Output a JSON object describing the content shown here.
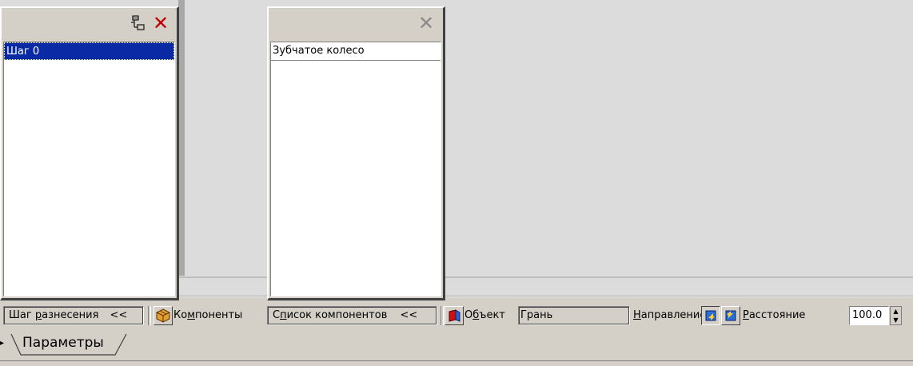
{
  "steps_panel": {
    "items": [
      "Шаг 0"
    ],
    "icons": [
      "tree-structure-icon",
      "delete-red-x-icon"
    ]
  },
  "components_panel": {
    "items": [
      "Зубчатое колесо"
    ],
    "icons": [
      "close-gray-x-icon"
    ]
  },
  "toolbar": {
    "step_field": {
      "text_underlined_prefix": "Шаг ",
      "text_underlined": "р",
      "text_rest": "азнесения",
      "suffix": "<<"
    },
    "components_label": {
      "pre": "Ко",
      "underlined": "м",
      "post": "поненты"
    },
    "components_list_field": {
      "pre": "С",
      "underlined": "п",
      "post": "исок компонентов",
      "suffix": "<<"
    },
    "object_label": {
      "pre": "О",
      "underlined": "б",
      "post": "ъект"
    },
    "object_value": "Грань",
    "direction_label": {
      "underlined": "Н",
      "post": "аправление"
    },
    "distance_label": {
      "underlined": "Р",
      "post": "асстояние"
    },
    "distance_value": "100.0"
  },
  "tabs": [
    {
      "label": "Параметры",
      "active": true
    }
  ],
  "colors": {
    "background": "#d4d0c8",
    "selection": "#0a2aa5",
    "delete_red": "#c00000"
  }
}
